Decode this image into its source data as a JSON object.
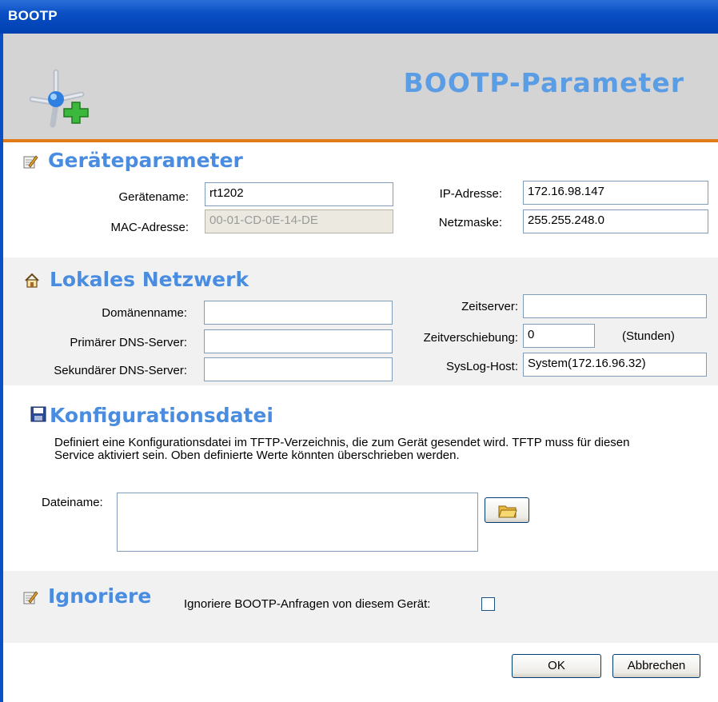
{
  "window": {
    "title": "BOOTP"
  },
  "banner": {
    "title": "BOOTP-Parameter",
    "icon": "network-add-icon"
  },
  "geraeteparameter": {
    "title": "Geräteparameter",
    "icon": "edit-icon",
    "geraetename": {
      "label": "Gerätename:",
      "value": "rt1202"
    },
    "mac": {
      "label": "MAC-Adresse:",
      "value": "00-01-CD-0E-14-DE"
    },
    "ip": {
      "label": "IP-Adresse:",
      "value": "172.16.98.147"
    },
    "netzmaske": {
      "label": "Netzmaske:",
      "value": "255.255.248.0"
    }
  },
  "netzwerk": {
    "title": "Lokales Netzwerk",
    "icon": "home-icon",
    "domaene": {
      "label": "Domänenname:",
      "value": ""
    },
    "dns1": {
      "label": "Primärer DNS-Server:",
      "value": ""
    },
    "dns2": {
      "label": "Sekundärer DNS-Server:",
      "value": ""
    },
    "zeitserver": {
      "label": "Zeitserver:",
      "value": ""
    },
    "zeitverschiebung": {
      "label": "Zeitverschiebung:",
      "value": "0",
      "unit": "(Stunden)"
    },
    "syslog": {
      "label": "SysLog-Host:",
      "value": "System(172.16.96.32)"
    }
  },
  "konfig": {
    "title": "Konfigurationsdatei",
    "icon": "save-icon",
    "desc": "Definiert eine Konfigurationsdatei im TFTP-Verzeichnis, die zum Gerät gesendet wird. TFTP muss für diesen Service aktiviert sein. Oben definierte Werte könnten überschrieben werden.",
    "dateiname": {
      "label": "Dateiname:",
      "value": ""
    },
    "browse_icon": "folder-open-icon"
  },
  "ignoriere": {
    "title": "Ignoriere",
    "icon": "edit-icon",
    "label": "Ignoriere BOOTP-Anfragen von diesem Gerät:",
    "checked": false
  },
  "buttons": {
    "ok": "OK",
    "cancel": "Abbrechen"
  },
  "colors": {
    "titlebar": "#0a4fc4",
    "accent": "#4a8de0",
    "banner_bg": "#d4d4d4",
    "separator": "#e07b1a"
  }
}
